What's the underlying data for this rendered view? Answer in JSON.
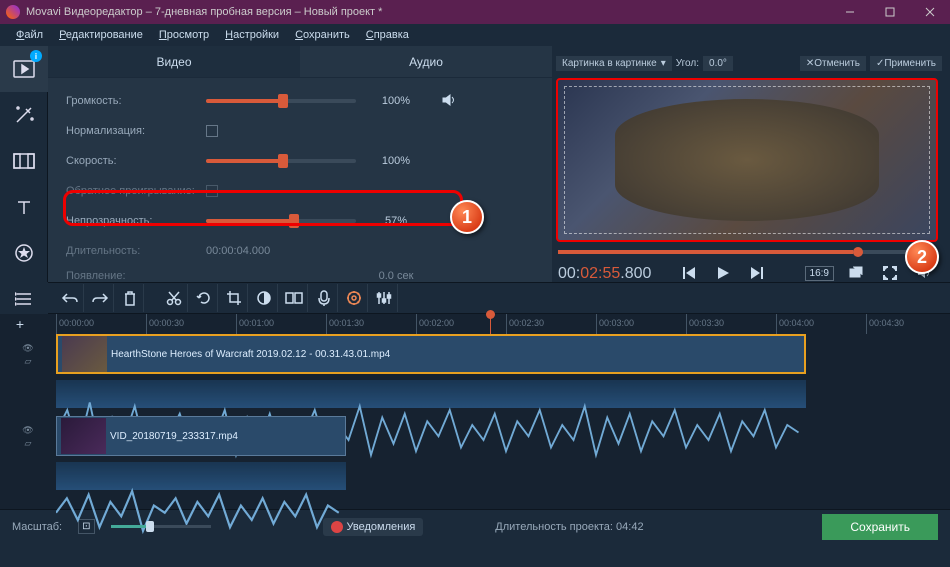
{
  "titlebar": {
    "title": "Movavi Видеоредактор – 7-дневная пробная версия – Новый проект *"
  },
  "menu": {
    "file": "Файл",
    "edit": "Редактирование",
    "view": "Просмотр",
    "settings": "Настройки",
    "save": "Сохранить",
    "help": "Справка"
  },
  "tabs": {
    "video": "Видео",
    "audio": "Аудио"
  },
  "props": {
    "volume": {
      "label": "Громкость:",
      "value": "100%",
      "pct": 50
    },
    "normalize": {
      "label": "Нормализация:"
    },
    "speed": {
      "label": "Скорость:",
      "value": "100%",
      "pct": 50
    },
    "reverse": {
      "label": "Обратное проигрывание:"
    },
    "opacity": {
      "label": "Непрозрачность:",
      "value": "57%",
      "pct": 57
    },
    "duration": {
      "label": "Длительность:",
      "value": "00:00:04.000"
    },
    "fadein": {
      "label": "Появление:",
      "value": "0.0 сек"
    }
  },
  "preview": {
    "combo": "Картинка в картинке",
    "angle_label": "Угол:",
    "angle_value": "0.0°",
    "cancel": "Отменить",
    "apply": "Применить",
    "timecode_pre": "00:",
    "timecode_hl": "02:55",
    "timecode_post": ".800",
    "ratio": "16:9"
  },
  "ruler": {
    "ticks": [
      "00:00:00",
      "00:00:30",
      "00:01:00",
      "00:01:30",
      "00:02:00",
      "00:02:30",
      "00:03:00",
      "00:03:30",
      "00:04:00",
      "00:04:30"
    ]
  },
  "clips": {
    "clip1": "HearthStone  Heroes of Warcraft 2019.02.12 - 00.31.43.01.mp4",
    "clip2": "VID_20180719_233317.mp4"
  },
  "bottom": {
    "scale": "Масштаб:",
    "notif": "Уведомления",
    "duration_label": "Длительность проекта:  04:42",
    "save": "Сохранить"
  },
  "callouts": {
    "one": "1",
    "two": "2"
  }
}
